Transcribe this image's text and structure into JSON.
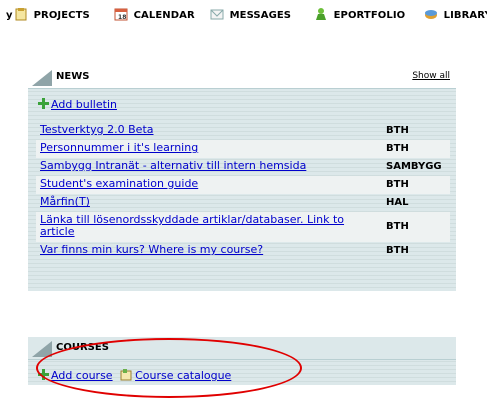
{
  "topnav": {
    "leading": "у",
    "items": [
      {
        "label": "PROJECTS",
        "icon": "clipboard-icon"
      },
      {
        "label": "CALENDAR",
        "icon": "calendar-icon"
      },
      {
        "label": "MESSAGES",
        "icon": "envelope-icon"
      },
      {
        "label": "EPORTFOLIO",
        "icon": "portfolio-icon"
      },
      {
        "label": "LIBRARY",
        "icon": "library-icon"
      }
    ]
  },
  "news": {
    "title": "NEWS",
    "show_all": "Show all",
    "add_label": "Add bulletin",
    "items": [
      {
        "title": "Testverktyg 2.0 Beta",
        "source": "BTH"
      },
      {
        "title": "Personnummer i it's learning",
        "source": "BTH"
      },
      {
        "title": "Sambygg Intranät - alternativ till intern hemsida",
        "source": "SAMBYGG"
      },
      {
        "title": "Student's examination guide",
        "source": "BTH"
      },
      {
        "title": "Mårfin(T)",
        "source": "HAL"
      },
      {
        "title": "Länka till lösenordsskyddade artiklar/databaser. Link to article",
        "source": "BTH"
      },
      {
        "title": "Var finns min kurs? Where is my course?",
        "source": "BTH"
      }
    ]
  },
  "courses": {
    "title": "COURSES",
    "add_label": "Add course",
    "catalogue_label": "Course catalogue"
  },
  "colors": {
    "panel_bg": "#dce8ea",
    "link": "#0000cc",
    "highlight": "#e00000"
  }
}
